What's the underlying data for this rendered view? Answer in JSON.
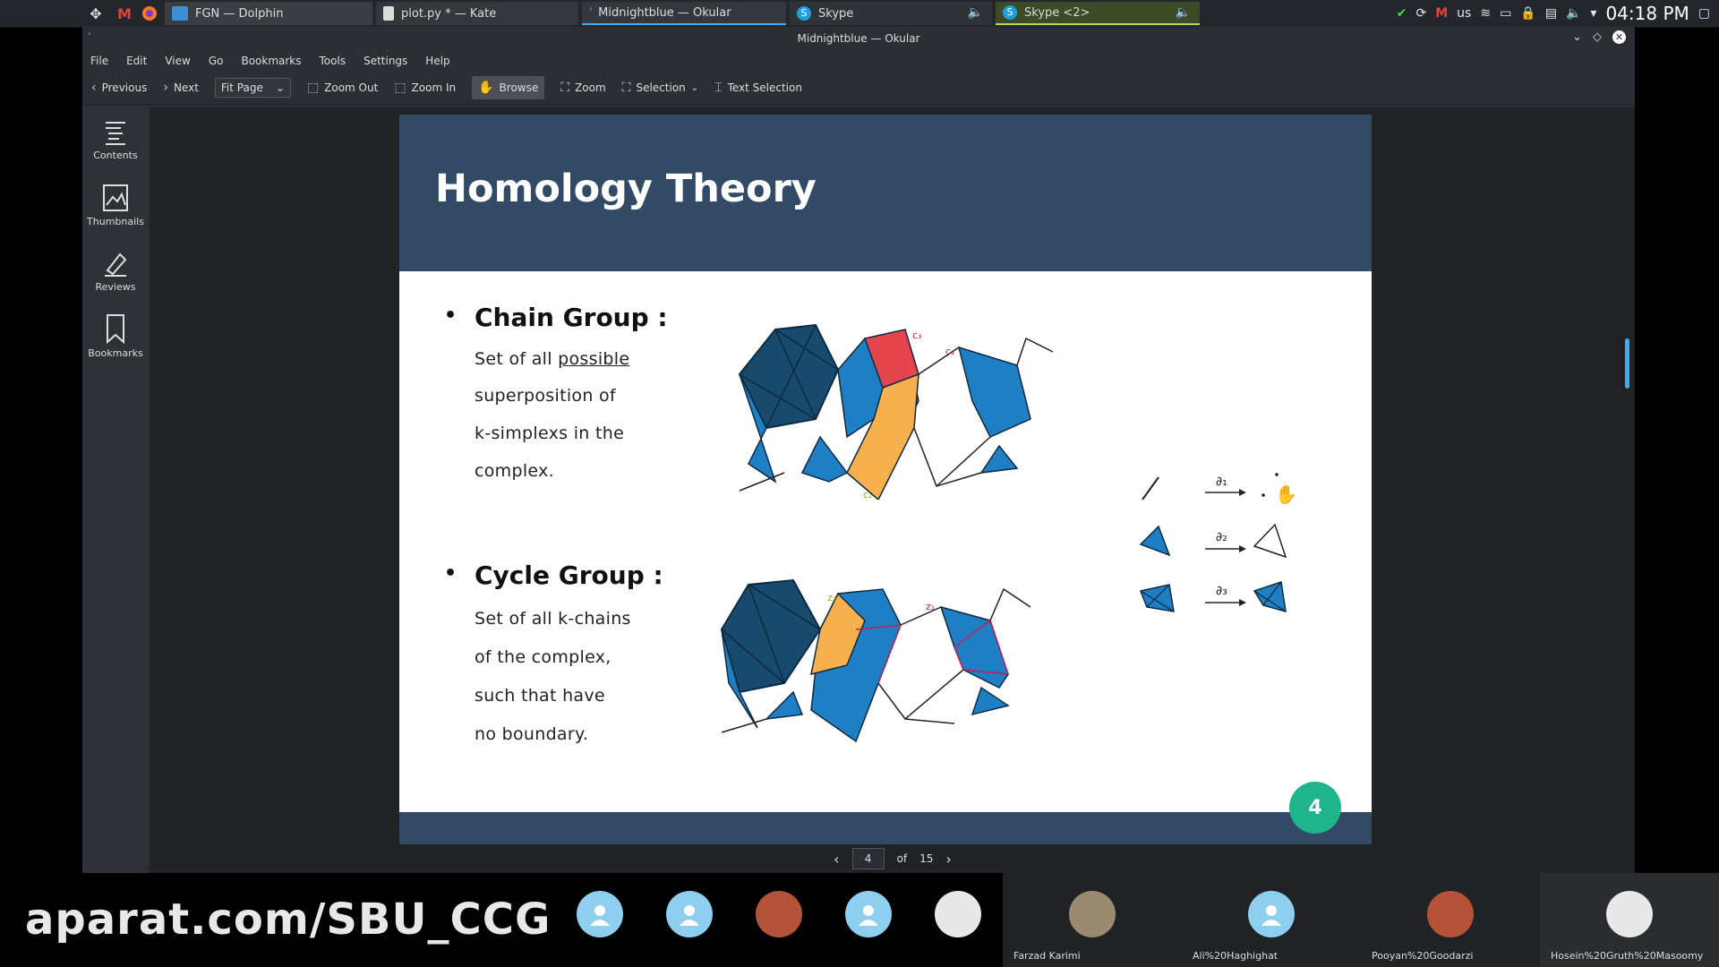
{
  "taskbar": {
    "tasks": [
      {
        "label": "FGN — Dolphin"
      },
      {
        "label": "plot.py * — Kate"
      },
      {
        "label": "Midnightblue — Okular"
      },
      {
        "label": "Skype"
      },
      {
        "label": "Skype <2>"
      }
    ],
    "tray": {
      "layout": "us",
      "clock": "04:18 PM"
    }
  },
  "window": {
    "title": "Midnightblue — Okular",
    "menu": [
      "File",
      "Edit",
      "View",
      "Go",
      "Bookmarks",
      "Tools",
      "Settings",
      "Help"
    ],
    "toolbar": {
      "previous": "Previous",
      "next": "Next",
      "fit": "Fit Page",
      "zoom_out": "Zoom Out",
      "zoom_in": "Zoom In",
      "browse": "Browse",
      "zoom": "Zoom",
      "selection": "Selection",
      "text_selection": "Text Selection"
    },
    "sidebar": [
      {
        "label": "Contents",
        "icon": "contents-icon"
      },
      {
        "label": "Thumbnails",
        "icon": "thumbnails-icon"
      },
      {
        "label": "Reviews",
        "icon": "reviews-icon"
      },
      {
        "label": "Bookmarks",
        "icon": "bookmarks-icon"
      }
    ],
    "pager": {
      "current": "4",
      "of_label": "of",
      "total": "15"
    }
  },
  "slide": {
    "title": "Homology Theory",
    "chain": {
      "heading": "Chain Group :",
      "lines": [
        "Set of all",
        "possible",
        "superposition of",
        "k-simplexs in the",
        "complex."
      ]
    },
    "cycle": {
      "heading": "Cycle Group :",
      "lines": [
        "Set of all k-chains",
        "of the complex,",
        "such that have",
        "no boundary."
      ]
    },
    "boundary_labels": [
      "∂₁",
      "∂₂",
      "∂₃"
    ],
    "diagram_labels": {
      "c1": "c₁",
      "c2": "c₂",
      "c3": "c₃",
      "z1": "z₁",
      "z2": "z₂"
    },
    "page_number": "4",
    "colors": {
      "header": "#324a66",
      "badge": "#20b48a",
      "blue": "#1e7fc4",
      "dark": "#174a6d",
      "orange": "#f6b04e",
      "red": "#e6444c"
    }
  },
  "bottom": {
    "watermark": "aparat.com/SBU_CCG",
    "participants": [
      "Farzad Karimi",
      "Ali%20Haghighat",
      "Pooyan%20Goodarzi",
      "Hosein%20Gruth%20Masoomy"
    ]
  }
}
